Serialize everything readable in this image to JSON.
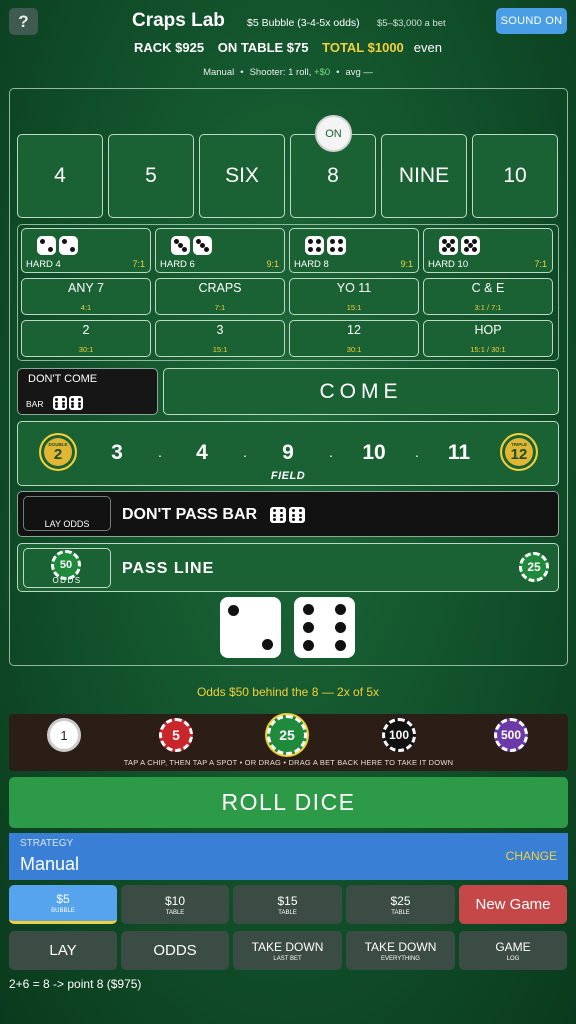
{
  "header": {
    "help_label": "?",
    "title": "Craps Lab",
    "subtitle": "$5 Bubble (3-4-5x odds)",
    "limits": "$5–$3,000 a bet",
    "sound_label": "SOUND  ON"
  },
  "stats": {
    "rack": "RACK $925",
    "on_table": "ON TABLE $75",
    "total": "TOTAL $1000",
    "status": "even"
  },
  "info": {
    "mode": "Manual",
    "shooter_prefix": "Shooter: 1 roll, ",
    "shooter_gain": "+$0",
    "avg": "avg —"
  },
  "puck_label": "ON",
  "numbers": [
    "4",
    "5",
    "SIX",
    "8",
    "NINE",
    "10"
  ],
  "hardways": [
    {
      "label": "HARD 4",
      "payout": "7:1"
    },
    {
      "label": "HARD 6",
      "payout": "9:1"
    },
    {
      "label": "HARD 8",
      "payout": "9:1"
    },
    {
      "label": "HARD 10",
      "payout": "7:1"
    }
  ],
  "props_row1": [
    {
      "label": "ANY 7",
      "payout": "4:1"
    },
    {
      "label": "CRAPS",
      "payout": "7:1"
    },
    {
      "label": "YO 11",
      "payout": "15:1"
    },
    {
      "label": "C & E",
      "payout": "3:1 / 7:1"
    }
  ],
  "props_row2": [
    {
      "label": "2",
      "payout": "30:1"
    },
    {
      "label": "3",
      "payout": "15:1"
    },
    {
      "label": "12",
      "payout": "30:1"
    },
    {
      "label": "HOP",
      "payout": "15:1 / 30:1"
    }
  ],
  "dont_come": {
    "label": "DON'T COME",
    "bar": "BAR"
  },
  "come_label": "COME",
  "field": {
    "label": "FIELD",
    "numbers": [
      "3",
      "4",
      "9",
      "10",
      "11"
    ],
    "left_badge": {
      "top": "DOUBLE",
      "num": "2"
    },
    "right_badge": {
      "top": "TRIPLE",
      "num": "12"
    }
  },
  "dont_pass": {
    "label": "DON'T PASS BAR",
    "lay_odds": "LAY  ODDS"
  },
  "pass_line": {
    "label": "PASS  LINE",
    "odds_label": "ODDS",
    "odds_chip": "50",
    "bet_chip": "25"
  },
  "dice": [
    2,
    6
  ],
  "odds_message": "Odds $50 behind the 8  —  2x of 5x",
  "chips": [
    {
      "value": "1",
      "color": "#ffffff"
    },
    {
      "value": "5",
      "color": "#c8262b"
    },
    {
      "value": "25",
      "color": "#1f8a3b"
    },
    {
      "value": "100",
      "color": "#111111"
    },
    {
      "value": "500",
      "color": "#6b3aa8"
    }
  ],
  "tray_hint": "TAP A CHIP, THEN TAP A SPOT  •  OR DRAG  •  DRAG A BET BACK HERE TO TAKE IT DOWN",
  "roll_label": "ROLL  DICE",
  "strategy": {
    "label": "STRATEGY",
    "value": "Manual",
    "change": "CHANGE"
  },
  "table_buttons": [
    {
      "main": "$5",
      "sub": "BUBBLE"
    },
    {
      "main": "$10",
      "sub": "TABLE"
    },
    {
      "main": "$15",
      "sub": "TABLE"
    },
    {
      "main": "$25",
      "sub": "TABLE"
    },
    {
      "main": "New Game",
      "sub": ""
    }
  ],
  "action_buttons": [
    {
      "main": "LAY",
      "sub": ""
    },
    {
      "main": "ODDS",
      "sub": ""
    },
    {
      "main": "TAKE DOWN",
      "sub": "LAST BET"
    },
    {
      "main": "TAKE DOWN",
      "sub": "EVERYTHING"
    },
    {
      "main": "GAME",
      "sub": "LOG"
    }
  ],
  "log_line": "2+6 = 8   ->   point 8    ($975)"
}
